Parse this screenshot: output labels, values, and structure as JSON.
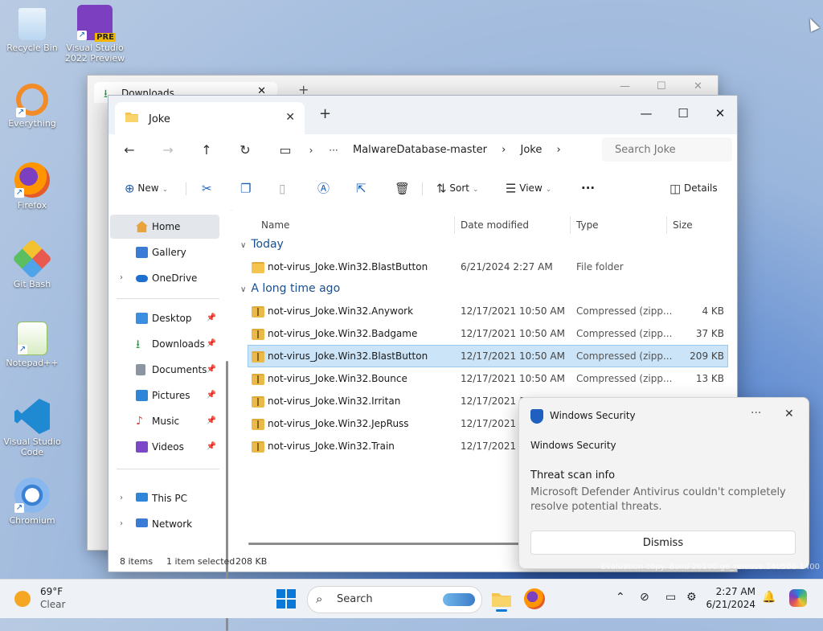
{
  "desktop_icons": [
    {
      "label": "Recycle Bin",
      "icon": "recycle-bin-icon",
      "color": "#d0e4f7"
    },
    {
      "label": "Visual Studio 2022 Preview",
      "icon": "visual-studio-preview-icon",
      "badge": "PRE",
      "color": "#7b3fbf"
    },
    {
      "label": "Everything",
      "icon": "everything-search-icon",
      "color": "#f28c28"
    },
    {
      "label": "Firefox",
      "icon": "firefox-icon",
      "color": "#e35a2b"
    },
    {
      "label": "Git Bash",
      "icon": "git-bash-icon",
      "color": "#e85a4f"
    },
    {
      "label": "Notepad++",
      "icon": "notepad-plus-plus-icon",
      "color": "#8fc15d"
    },
    {
      "label": "Visual Studio Code",
      "icon": "vscode-icon",
      "color": "#1f8ad2"
    },
    {
      "label": "Chromium",
      "icon": "chromium-icon",
      "color": "#3b82d6"
    }
  ],
  "bg_window": {
    "tab_title": "Downloads"
  },
  "window": {
    "tab_title": "Joke",
    "breadcrumb": [
      "MalwareDatabase-master",
      "Joke"
    ],
    "search_placeholder": "Search Joke",
    "toolbar": {
      "new_label": "New",
      "sort_label": "Sort",
      "view_label": "View",
      "more_label": "···",
      "details_label": "Details"
    },
    "nav": [
      {
        "label": "Home",
        "icon": "home-icon",
        "color": "#e8a33d"
      },
      {
        "label": "Gallery",
        "icon": "gallery-icon",
        "color": "#3a7bd5"
      },
      {
        "label": "OneDrive",
        "icon": "onedrive-icon",
        "color": "#1f6fd1"
      },
      {
        "label": "Desktop",
        "icon": "desktop-folder-icon",
        "color": "#3d8de0"
      },
      {
        "label": "Downloads",
        "icon": "downloads-folder-icon",
        "color": "#2e9a4b"
      },
      {
        "label": "Documents",
        "icon": "documents-folder-icon",
        "color": "#8a94a3"
      },
      {
        "label": "Pictures",
        "icon": "pictures-folder-icon",
        "color": "#2f86d8"
      },
      {
        "label": "Music",
        "icon": "music-folder-icon",
        "color": "#d2493f"
      },
      {
        "label": "Videos",
        "icon": "videos-folder-icon",
        "color": "#7b48c8"
      },
      {
        "label": "This PC",
        "icon": "this-pc-icon",
        "color": "#2f86d8"
      },
      {
        "label": "Network",
        "icon": "network-icon",
        "color": "#3a7bd5"
      }
    ],
    "columns": [
      "Name",
      "Date modified",
      "Type",
      "Size"
    ],
    "groups": [
      "Today",
      "A long time ago"
    ],
    "files_today": [
      {
        "name": "not-virus_Joke.Win32.BlastButton",
        "date": "6/21/2024 2:27 AM",
        "type": "File folder",
        "size": ""
      }
    ],
    "files_old": [
      {
        "name": "not-virus_Joke.Win32.Anywork",
        "date": "12/17/2021 10:50 AM",
        "type": "Compressed (zipp...",
        "size": "4 KB"
      },
      {
        "name": "not-virus_Joke.Win32.Badgame",
        "date": "12/17/2021 10:50 AM",
        "type": "Compressed (zipp...",
        "size": "37 KB"
      },
      {
        "name": "not-virus_Joke.Win32.BlastButton",
        "date": "12/17/2021 10:50 AM",
        "type": "Compressed (zipp...",
        "size": "209 KB",
        "selected": true
      },
      {
        "name": "not-virus_Joke.Win32.Bounce",
        "date": "12/17/2021 10:50 AM",
        "type": "Compressed (zipp...",
        "size": "13 KB"
      },
      {
        "name": "not-virus_Joke.Win32.Irritan",
        "date": "12/17/2021 10",
        "type": "",
        "size": ""
      },
      {
        "name": "not-virus_Joke.Win32.JepRuss",
        "date": "12/17/2021 10",
        "type": "",
        "size": ""
      },
      {
        "name": "not-virus_Joke.Win32.Train",
        "date": "12/17/2021 10",
        "type": "",
        "size": ""
      }
    ],
    "status": {
      "items": "8 items",
      "selected": "1 item selected",
      "size": "208 KB"
    }
  },
  "toast": {
    "app": "Windows Security",
    "more": "···",
    "source": "Windows Security",
    "title": "Threat scan info",
    "body": "Microsoft Defender Antivirus couldn't completely resolve potential threats.",
    "button": "Dismiss"
  },
  "taskbar": {
    "temp": "69°F",
    "condition": "Clear",
    "search_label": "Search",
    "time": "2:27 AM",
    "date": "6/21/2024",
    "accent": "#0a78d7"
  },
  "watermark": "Evaluation copy. Build 26100.ge_release.240506-1400"
}
